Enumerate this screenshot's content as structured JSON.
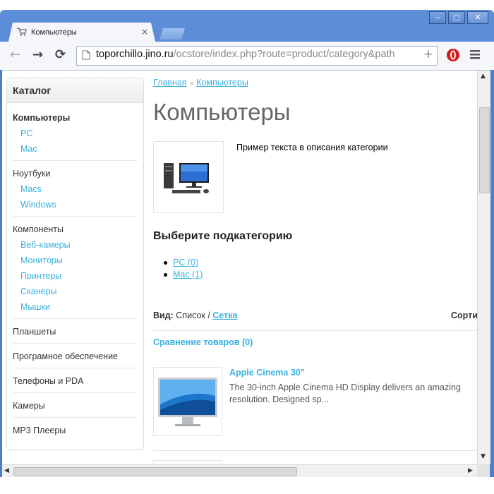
{
  "browser": {
    "tab_title": "Компьютеры",
    "tab_close": "×",
    "url_host": "toporchillo.jino.ru",
    "url_path": "/ocstore/index.php?route=product/category&path",
    "back_glyph": "←",
    "forward_glyph": "→",
    "reload_glyph": "⟳",
    "add_glyph": "+",
    "window_buttons": [
      "‒",
      "▢",
      "✕"
    ]
  },
  "sidebar": {
    "title": "Каталог",
    "groups": [
      {
        "label": "Компьютеры",
        "active": true,
        "children": [
          "PC",
          "Mac"
        ]
      },
      {
        "label": "Ноутбуки",
        "children": [
          "Macs",
          "Windows"
        ]
      },
      {
        "label": "Компоненты",
        "children": [
          "Веб-камеры",
          "Мониторы",
          "Принтеры",
          "Сканеры",
          "Мышки"
        ]
      },
      {
        "label": "Планшеты",
        "children": []
      },
      {
        "label": "Програмное обеспечение",
        "children": []
      },
      {
        "label": "Телефоны и PDA",
        "children": []
      },
      {
        "label": "Камеры",
        "children": []
      },
      {
        "label": "MP3 Плееры",
        "children": []
      }
    ]
  },
  "main": {
    "breadcrumb": [
      "Главная",
      "Компьютеры"
    ],
    "breadcrumb_sep": "»",
    "title": "Компьютеры",
    "description": "Пример текста в описания категории",
    "subcategory_heading": "Выберите подкатегорию",
    "subcategories": [
      "PC (0)",
      "Mac (1)"
    ],
    "view_label": "Вид:",
    "view_list": "Список",
    "view_sep": "/",
    "view_grid": "Сетка",
    "sort_label": "Сорти",
    "compare_link": "Сравнение товаров (0)",
    "product": {
      "name": "Apple Cinema 30\"",
      "desc_line1": "The 30-inch Apple Cinema HD Display delivers an amazing",
      "desc_line2": "resolution. Designed sp..."
    }
  },
  "colors": {
    "link": "#38b0de",
    "frame": "#4a7fcf",
    "title": "#666666"
  }
}
